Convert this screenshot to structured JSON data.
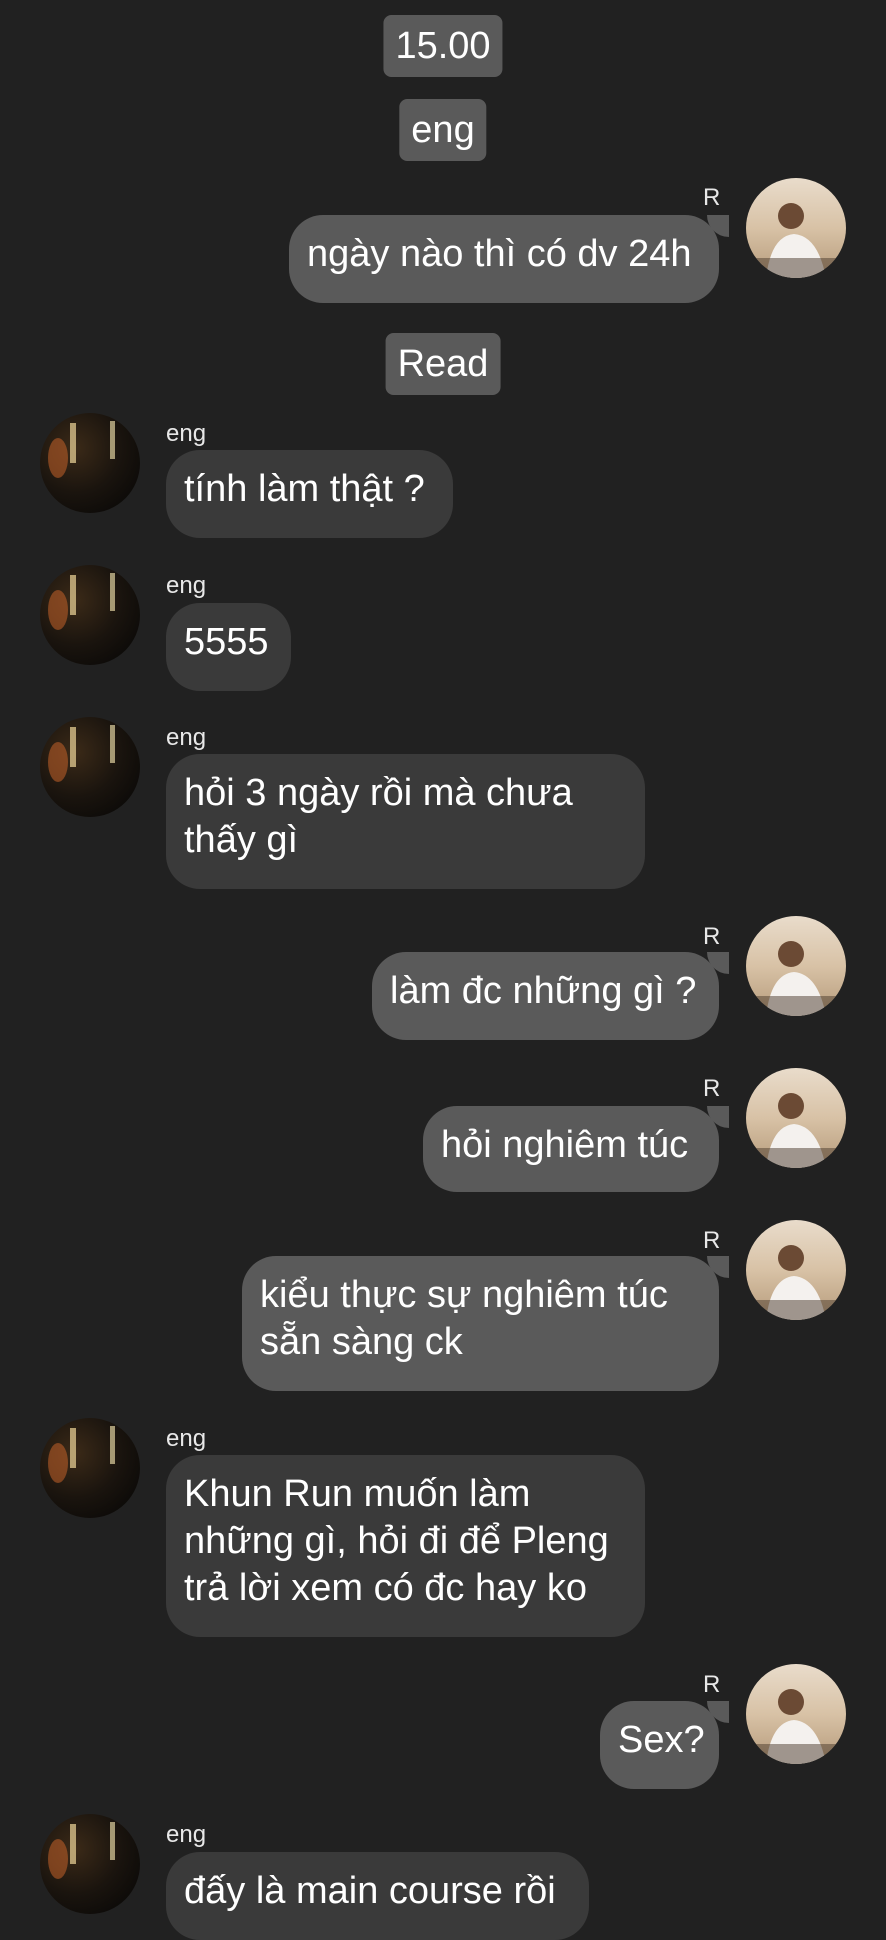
{
  "time_chip": "15.00",
  "name_chip": "eng",
  "read_chip": "Read",
  "sender_in": "eng",
  "sender_out": "R",
  "messages": {
    "m1": "ngày nào thì có dv 24h",
    "m2": "tính làm thật ?",
    "m3": "5555",
    "m4_line1": "hỏi 3 ngày rồi mà chưa",
    "m4_line2": "thấy gì",
    "m5": "làm đc những gì ?",
    "m6": "hỏi nghiêm túc",
    "m7_line1": "kiểu thực sự nghiêm túc",
    "m7_line2": "sẵn sàng ck",
    "m8_line1": "Khun Run muốn làm",
    "m8_line2": "những gì, hỏi đi để Pleng",
    "m8_line3": "trả lời xem có đc hay ko",
    "m9": "Sex?",
    "m10": "đấy là main course rồi"
  },
  "colors": {
    "background": "#212121",
    "bubble_incoming": "#3a3a3a",
    "bubble_outgoing": "#5a5a5a",
    "text": "#ffffff"
  },
  "icons": {
    "avatar_incoming": "avatar-dark-room-photo",
    "avatar_outgoing": "avatar-person-photo"
  }
}
